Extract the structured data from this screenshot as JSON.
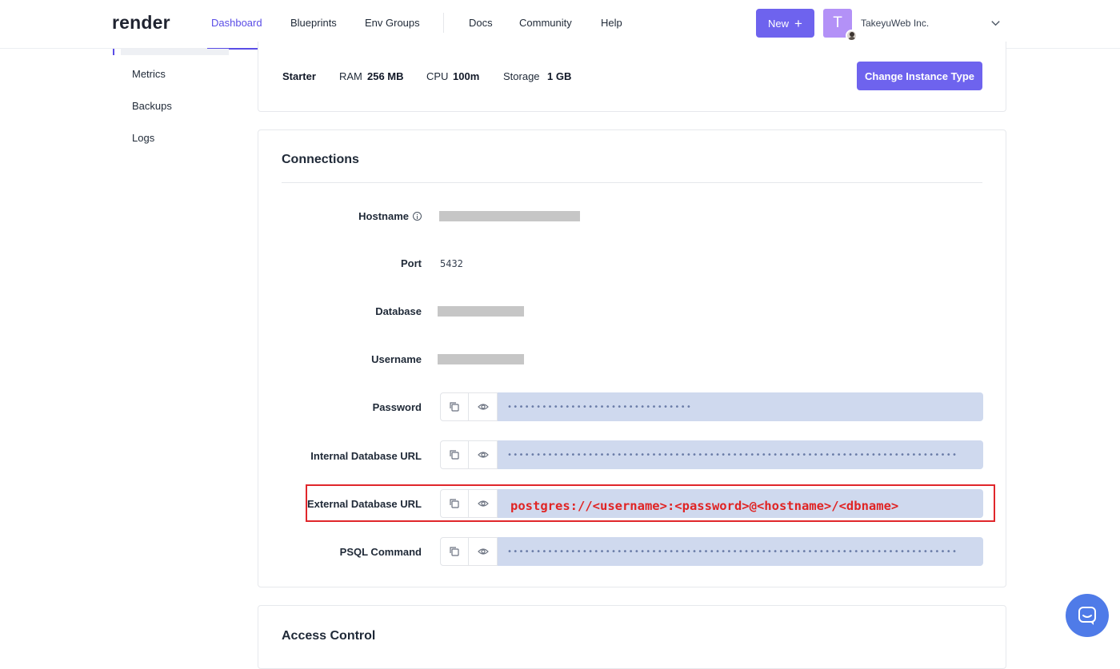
{
  "app": {
    "logo": "render"
  },
  "nav": {
    "links": [
      "Dashboard",
      "Blueprints",
      "Env Groups",
      "Docs",
      "Community",
      "Help"
    ],
    "active": "Dashboard",
    "new_label": "New",
    "avatar_letter": "T",
    "org_name": "TakeyuWeb Inc."
  },
  "sidebar": {
    "items": [
      "Metrics",
      "Backups",
      "Logs"
    ]
  },
  "instance": {
    "plan": "Starter",
    "ram_label": "RAM",
    "ram_value": "256 MB",
    "cpu_label": "CPU",
    "cpu_value": "100m",
    "storage_label": "Storage",
    "storage_value": "1 GB",
    "change_button": "Change Instance Type"
  },
  "connections": {
    "title": "Connections",
    "hostname_label": "Hostname",
    "port_label": "Port",
    "port_value": "5432",
    "database_label": "Database",
    "username_label": "Username",
    "password_label": "Password",
    "password_mask": "••••••••••••••••••••••••••••••••",
    "internal_url_label": "Internal Database URL",
    "internal_url_mask": "••••••••••••••••••••••••••••••••••••••••••••••••••••••••••••••••••••••••••••••",
    "external_url_label": "External Database URL",
    "external_url_value": "postgres://<username>:<password>@<hostname>/<dbname>",
    "psql_label": "PSQL Command",
    "psql_mask": "••••••••••••••••••••••••••••••••••••••••••••••••••••••••••••••••••••••••••••••"
  },
  "access_control": {
    "title": "Access Control"
  },
  "colors": {
    "accent": "#6e63ee",
    "highlight": "#e0262b",
    "secret_bg": "#cfd9ee"
  }
}
